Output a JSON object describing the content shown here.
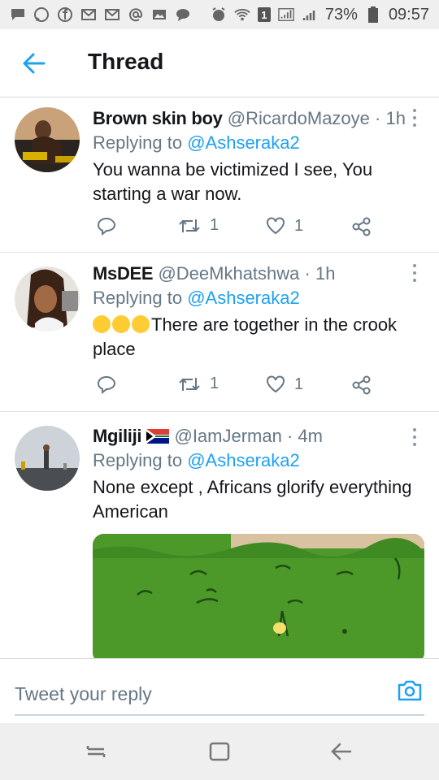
{
  "status_bar": {
    "battery": "73%",
    "time": "09:57",
    "sim_badge": "1"
  },
  "header": {
    "title": "Thread"
  },
  "tweets": [
    {
      "name": "Brown skin boy",
      "handle": "@RicardoMazoye",
      "time": "· 1h",
      "replying_label": "Replying to",
      "replying_handle": "@Ashseraka2",
      "text": "You wanna be victimized I see, You starting a war now.",
      "retweets": "1",
      "likes": "1"
    },
    {
      "name": "MsDEE",
      "handle": "@DeeMkhatshwa",
      "time": "· 1h",
      "replying_label": "Replying to",
      "replying_handle": "@Ashseraka2",
      "text": "There are together in the crook place",
      "retweets": "1",
      "likes": "1"
    },
    {
      "name": "Mgiliji",
      "handle": "@IamJerman",
      "time": "· 4m",
      "replying_label": "Replying to",
      "replying_handle": "@Ashseraka2",
      "text": "None except , Africans glorify everything American"
    }
  ],
  "reply_bar": {
    "placeholder": "Tweet your reply"
  },
  "colors": {
    "accent": "#1da1f2",
    "muted": "#657786",
    "text": "#14171a"
  }
}
